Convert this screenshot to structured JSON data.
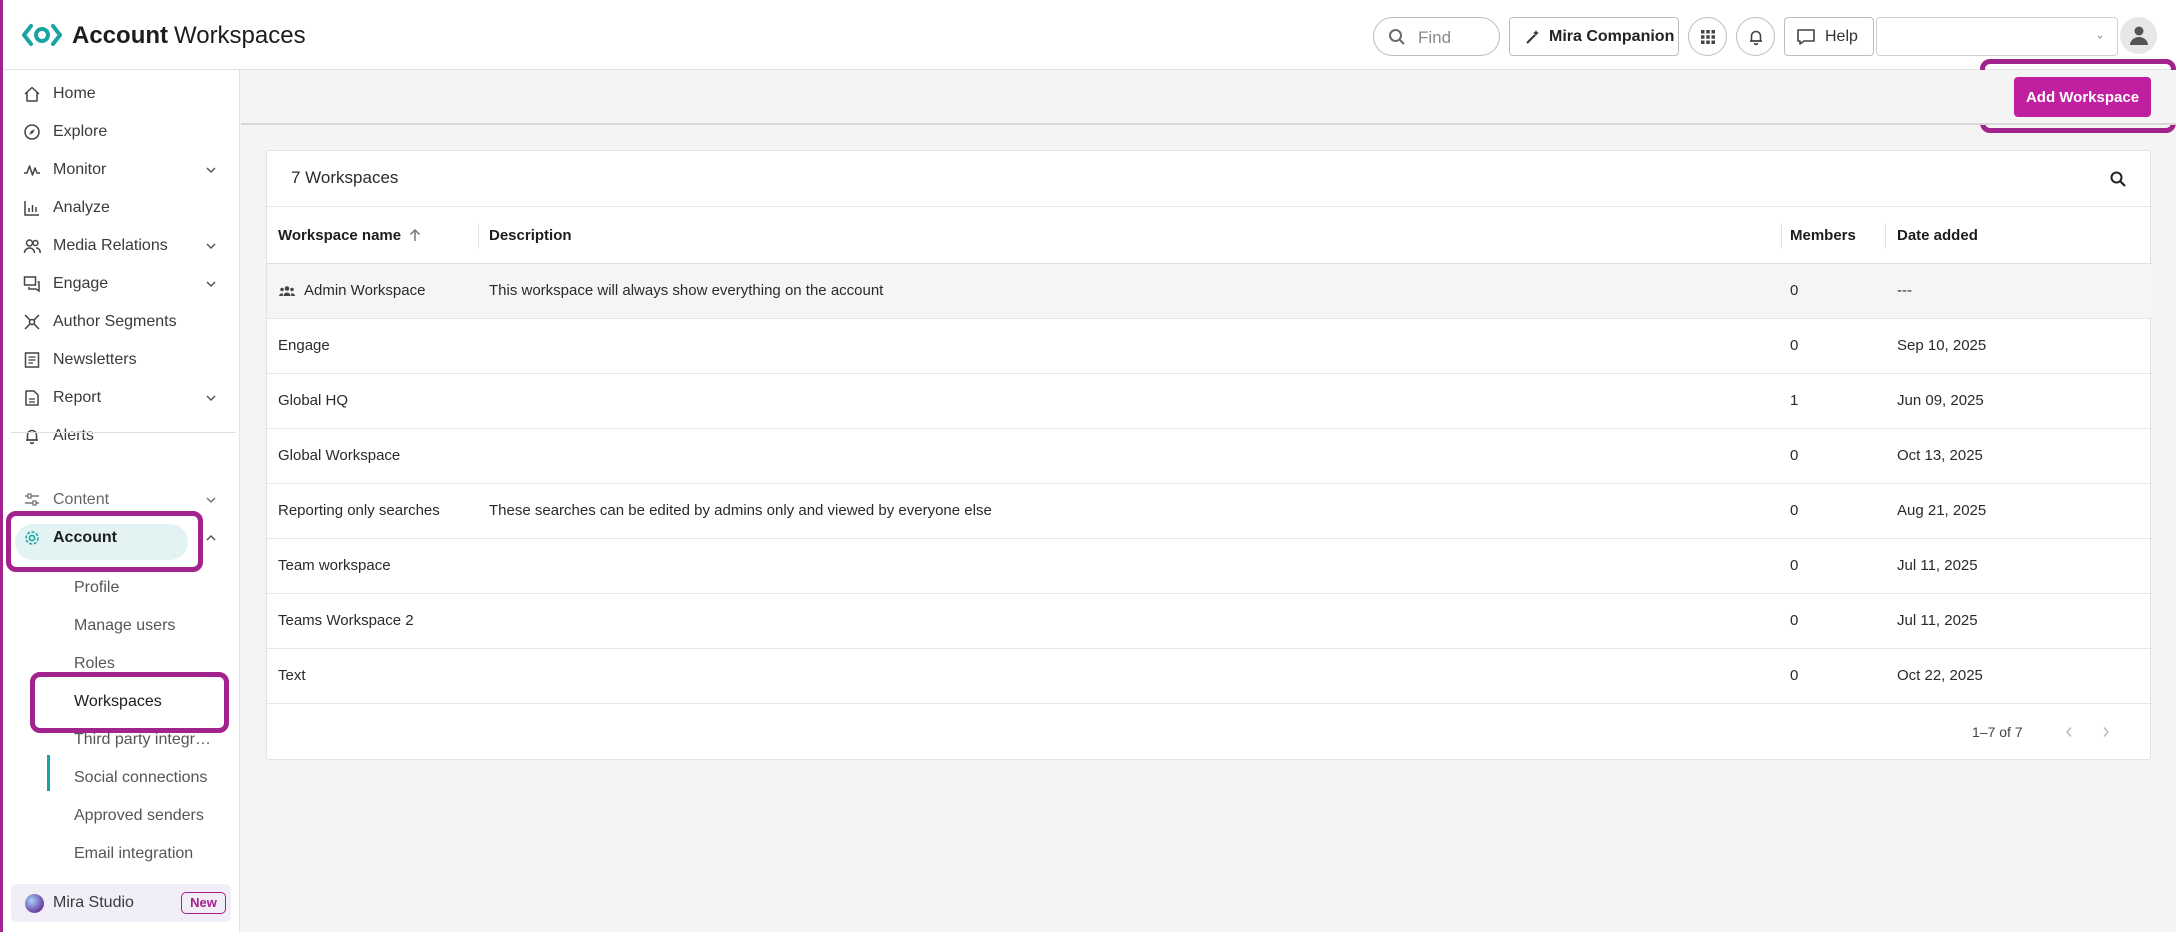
{
  "header": {
    "title_bold": "Account",
    "title_rest": "Workspaces",
    "find_placeholder": "Find",
    "companion_label": "Mira Companion",
    "help_label": "Help",
    "account_selector_value": ""
  },
  "sidebar": {
    "items": [
      {
        "label": "Home",
        "icon": "home-icon",
        "has_chevron": false
      },
      {
        "label": "Explore",
        "icon": "compass-icon",
        "has_chevron": false
      },
      {
        "label": "Monitor",
        "icon": "pulse-icon",
        "has_chevron": true
      },
      {
        "label": "Analyze",
        "icon": "bar-chart-icon",
        "has_chevron": false
      },
      {
        "label": "Media Relations",
        "icon": "people-icon",
        "has_chevron": true
      },
      {
        "label": "Engage",
        "icon": "chat-icon",
        "has_chevron": true
      },
      {
        "label": "Author Segments",
        "icon": "network-icon",
        "has_chevron": false
      },
      {
        "label": "Newsletters",
        "icon": "newsletter-icon",
        "has_chevron": false
      },
      {
        "label": "Report",
        "icon": "report-icon",
        "has_chevron": true
      },
      {
        "label": "Alerts",
        "icon": "bell-icon",
        "has_chevron": false
      }
    ],
    "content_label": "Content",
    "account_label": "Account",
    "account_sub": [
      "Profile",
      "Manage users",
      "Roles",
      "Workspaces",
      "Third party integrations",
      "Social connections",
      "Approved senders",
      "Email integration"
    ],
    "active_sub": "Workspaces",
    "mira_label": "Mira Studio",
    "mira_badge": "New"
  },
  "toolbar": {
    "add_label": "Add Workspace"
  },
  "table": {
    "title": "7 Workspaces",
    "columns": {
      "name": "Workspace name",
      "description": "Description",
      "members": "Members",
      "date": "Date added"
    },
    "rows": [
      {
        "name": "Admin Workspace",
        "description": "This workspace will always show everything on the account",
        "members": "0",
        "date": "---"
      },
      {
        "name": "Engage",
        "description": "",
        "members": "0",
        "date": "Sep 10, 2025"
      },
      {
        "name": "Global HQ",
        "description": "",
        "members": "1",
        "date": "Jun 09, 2025"
      },
      {
        "name": "Global Workspace",
        "description": "",
        "members": "0",
        "date": "Oct 13, 2025"
      },
      {
        "name": "Reporting only searches",
        "description": "These searches can be edited by admins only and viewed by everyone else",
        "members": "0",
        "date": "Aug 21, 2025"
      },
      {
        "name": "Team workspace",
        "description": "",
        "members": "0",
        "date": "Jul 11, 2025"
      },
      {
        "name": "Teams Workspace 2",
        "description": "",
        "members": "0",
        "date": "Jul 11, 2025"
      },
      {
        "name": "Text",
        "description": "",
        "members": "0",
        "date": "Oct 22, 2025"
      }
    ],
    "pagination": "1–7 of 7"
  },
  "colors": {
    "brand_teal": "#1aa3a3",
    "accent_magenta": "#c0209f",
    "highlight_border": "#a3238e"
  }
}
